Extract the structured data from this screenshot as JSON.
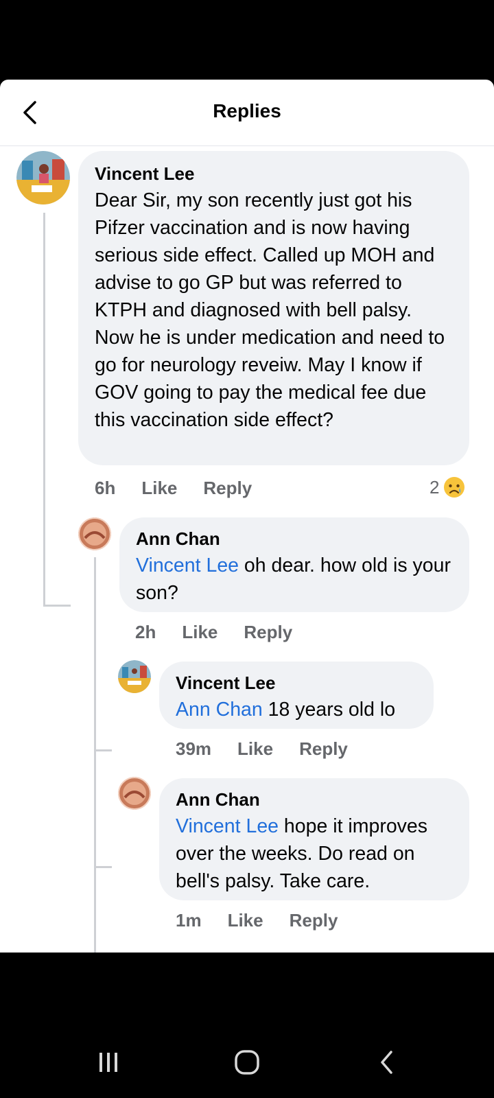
{
  "header": {
    "title": "Replies"
  },
  "comments": [
    {
      "author": "Vincent Lee",
      "mention": "",
      "text": "Dear Sir, my son recently just got his Pifzer vaccination and is now having serious side effect. Called up MOH and advise to go GP but was referred to KTPH and diagnosed with bell palsy. Now he is under medication and need to go for neurology reveiw. May I know if GOV going to pay the medical fee due this vaccination side effect?",
      "time": "6h",
      "like": "Like",
      "reply": "Reply",
      "reaction_count": "2",
      "reaction_icon": "sad-face-icon"
    },
    {
      "author": "Ann Chan",
      "mention": "Vincent Lee",
      "text": " oh dear. how old is your son?",
      "time": "2h",
      "like": "Like",
      "reply": "Reply"
    },
    {
      "author": "Vincent Lee",
      "mention": "Ann Chan",
      "text": " 18 years old lo",
      "time": "39m",
      "like": "Like",
      "reply": "Reply"
    },
    {
      "author": "Ann Chan",
      "mention": "Vincent Lee",
      "text": " hope it improves over the weeks. Do read on bell's palsy. Take care.",
      "time": "1m",
      "like": "Like",
      "reply": "Reply"
    }
  ],
  "colors": {
    "bubble": "#f0f2f5",
    "mention": "#216fdb",
    "meta": "#65676b"
  },
  "navbar": {
    "icons": [
      "recent-apps-icon",
      "home-icon",
      "back-icon"
    ]
  }
}
